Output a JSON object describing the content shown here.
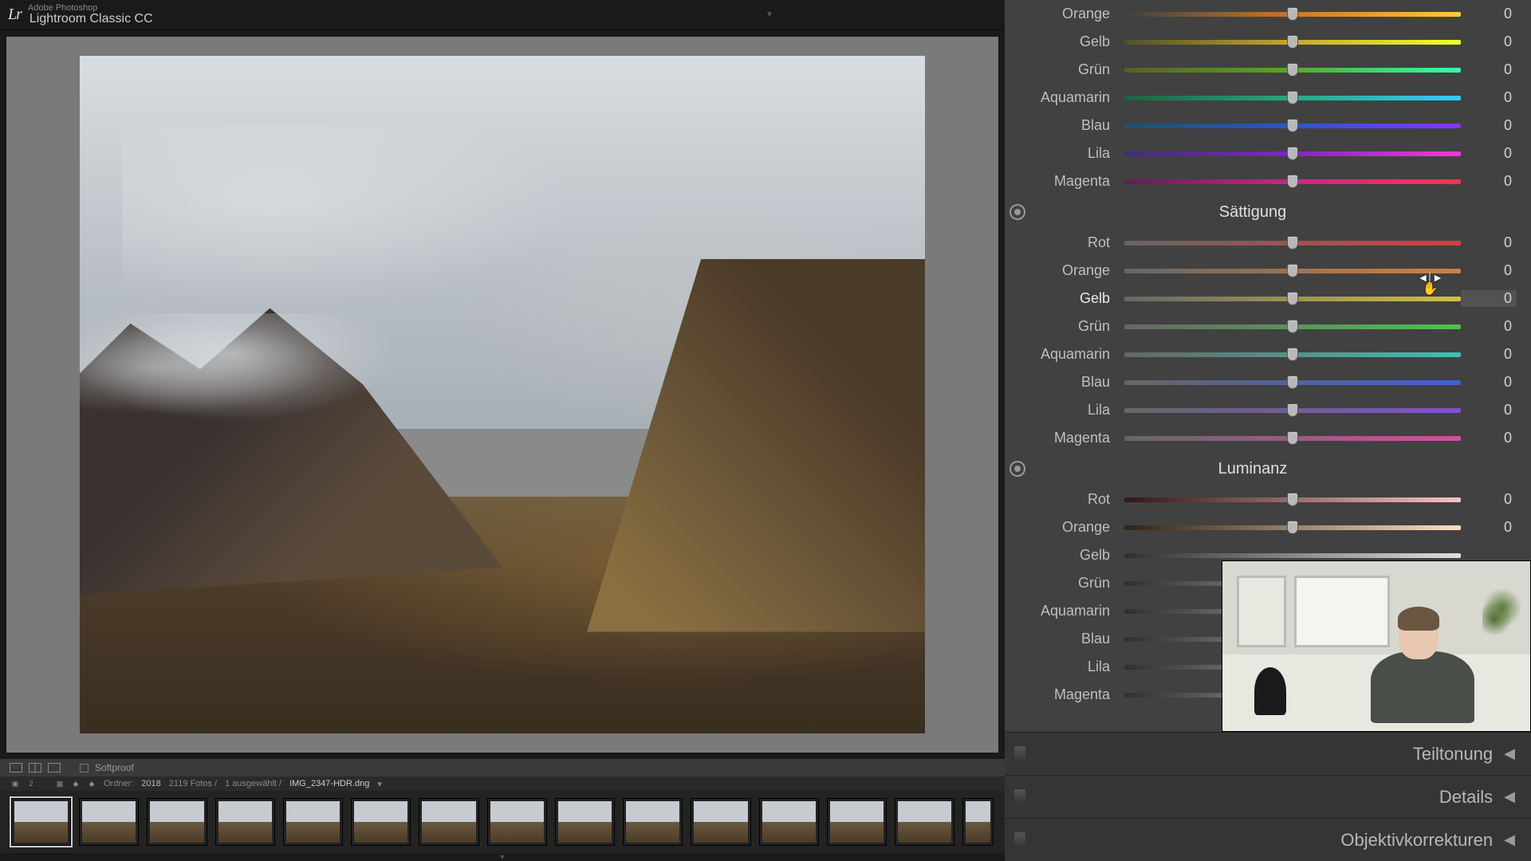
{
  "header": {
    "logo": "Lr",
    "subtitle": "Adobe Photoshop",
    "title": "Lightroom Classic CC"
  },
  "below": {
    "softproof": "Softproof"
  },
  "crumb": {
    "folder_label": "Ordner:",
    "folder": "2018",
    "count": "2119 Fotos /",
    "selected": "1 ausgewählt /",
    "file": "IMG_2347-HDR.dng",
    "chev": "▾"
  },
  "hue": {
    "orange": {
      "label": "Orange",
      "val": "0"
    },
    "gelb": {
      "label": "Gelb",
      "val": "0"
    },
    "gruen": {
      "label": "Grün",
      "val": "0"
    },
    "aqua": {
      "label": "Aquamarin",
      "val": "0"
    },
    "blau": {
      "label": "Blau",
      "val": "0"
    },
    "lila": {
      "label": "Lila",
      "val": "0"
    },
    "magenta": {
      "label": "Magenta",
      "val": "0"
    }
  },
  "sat": {
    "title": "Sättigung",
    "rot": {
      "label": "Rot",
      "val": "0"
    },
    "orange": {
      "label": "Orange",
      "val": "0"
    },
    "gelb": {
      "label": "Gelb",
      "val": "0"
    },
    "gruen": {
      "label": "Grün",
      "val": "0"
    },
    "aqua": {
      "label": "Aquamarin",
      "val": "0"
    },
    "blau": {
      "label": "Blau",
      "val": "0"
    },
    "lila": {
      "label": "Lila",
      "val": "0"
    },
    "magenta": {
      "label": "Magenta",
      "val": "0"
    }
  },
  "lum": {
    "title": "Luminanz",
    "rot": {
      "label": "Rot",
      "val": "0"
    },
    "orange": {
      "label": "Orange",
      "val": "0"
    },
    "gelb": {
      "label": "Gelb",
      "val": ""
    },
    "gruen": {
      "label": "Grün",
      "val": ""
    },
    "aqua": {
      "label": "Aquamarin",
      "val": ""
    },
    "blau": {
      "label": "Blau",
      "val": ""
    },
    "lila": {
      "label": "Lila",
      "val": ""
    },
    "magenta": {
      "label": "Magenta",
      "val": ""
    }
  },
  "sections": {
    "teiltonung": "Teiltonung",
    "details": "Details",
    "objektiv": "Objektivkorrekturen"
  }
}
